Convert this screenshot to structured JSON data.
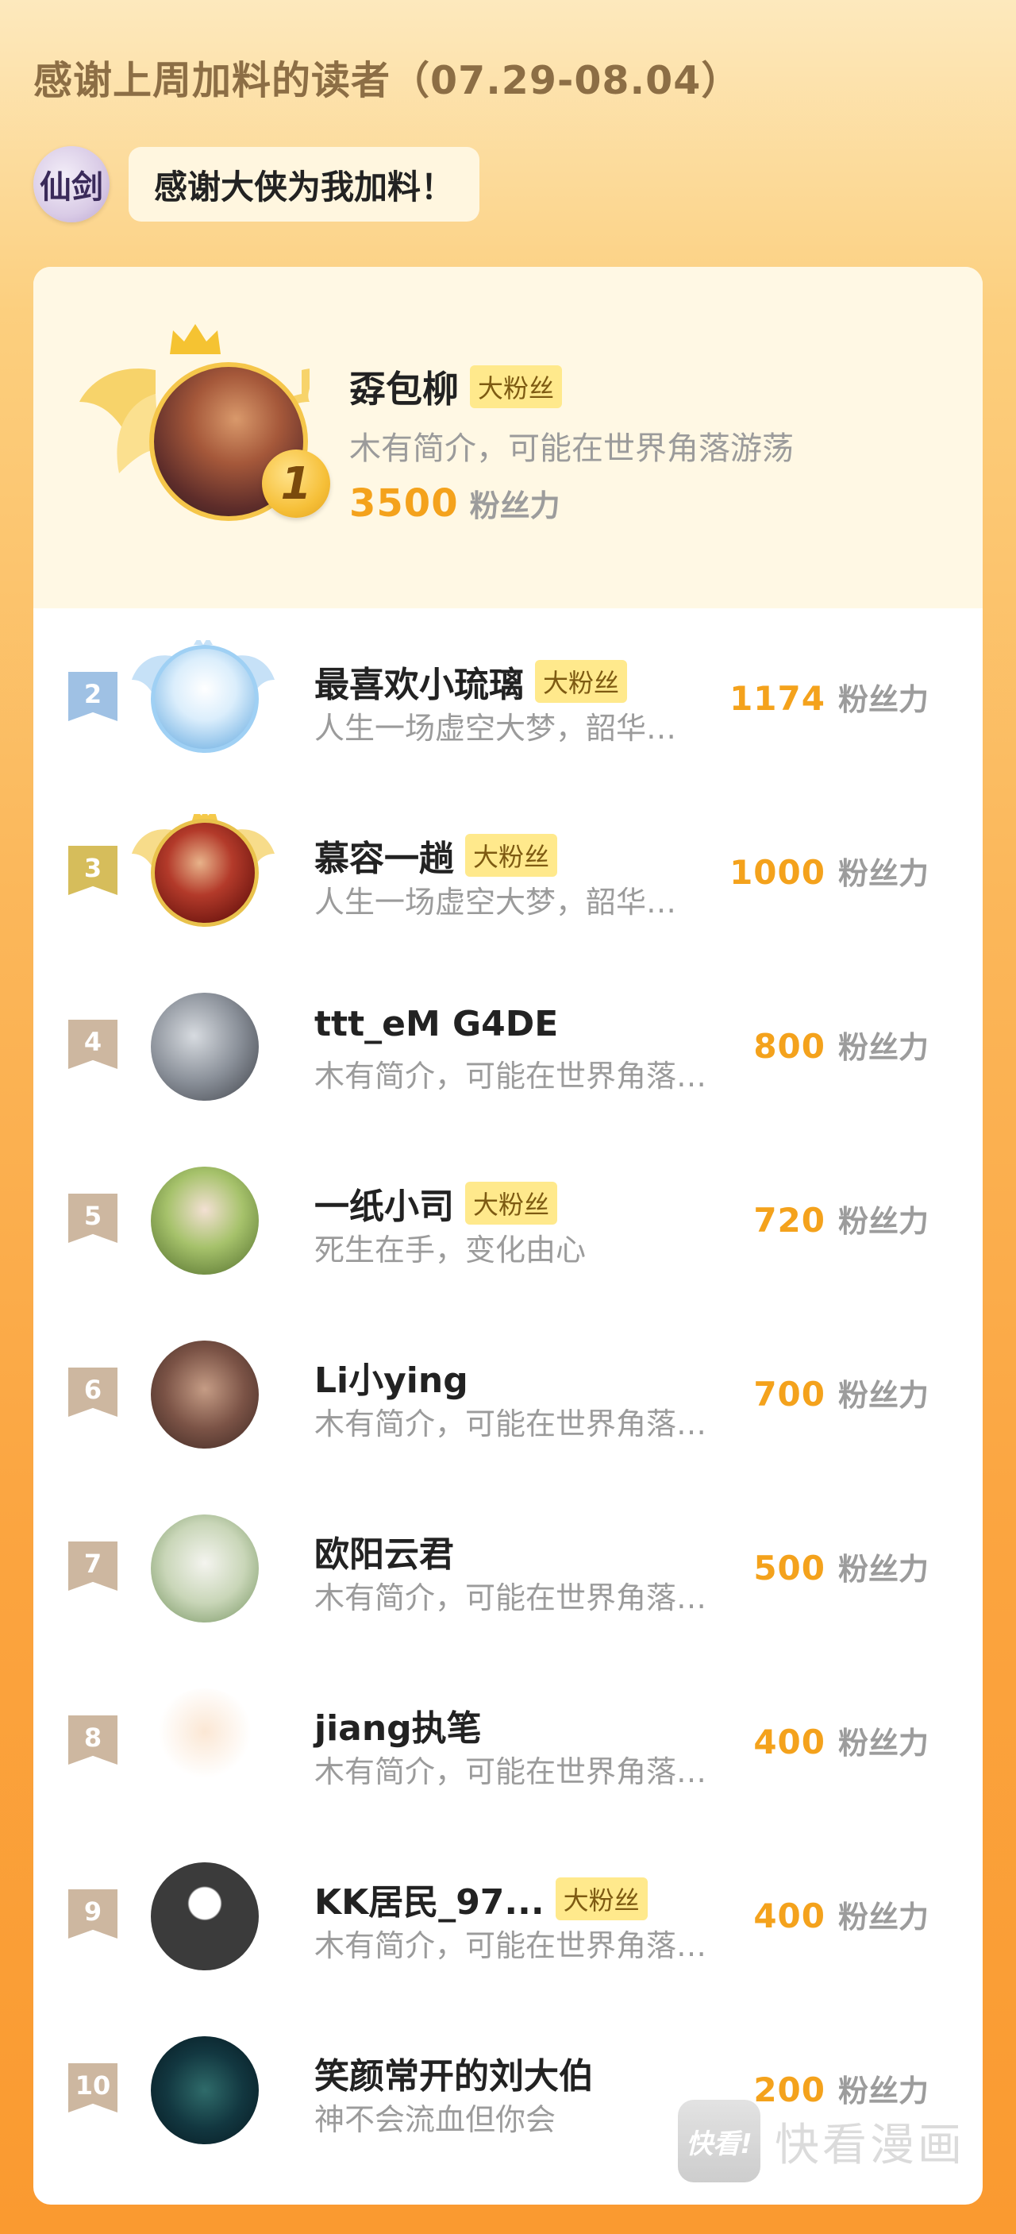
{
  "title": "感谢上周加料的读者（07.29-08.04）",
  "author": {
    "logo_text": "仙剑",
    "thanks_message": "感谢大侠为我加料！"
  },
  "fans_unit": "粉丝力",
  "top_fan": {
    "rank": "1",
    "name": "孬包柳",
    "badge": "大粉丝",
    "bio": "木有简介，可能在世界角落游荡",
    "fans": "3500"
  },
  "fans_list": [
    {
      "rank": "2",
      "name": "最喜欢小琉璃",
      "badge": "大粉丝",
      "bio": "人生一场虚空大梦，韶华…",
      "fans": "1174",
      "flag_color": "#9fc1e4",
      "avatar_style": "radial-gradient(circle at 50% 40%, #ffffff 0%, #dbeefc 40%, #86bde8 80%, #5a9ad4 100%)",
      "avatar_border": "5px solid #9fd0f4",
      "wings": "blue"
    },
    {
      "rank": "3",
      "name": "慕容一趟",
      "badge": "大粉丝",
      "bio": "人生一场虚空大梦，韶华…",
      "fans": "1000",
      "flag_color": "#d6bd5b",
      "avatar_style": "radial-gradient(circle at 45% 40%, #e8b38a 0%, #b33a2a 40%, #7a1c14 75%, #3d120c 100%)",
      "avatar_border": "5px solid #e9c24c",
      "wings": "gold"
    },
    {
      "rank": "4",
      "name": "ttt_eM G4DE",
      "badge": "",
      "bio": "木有简介，可能在世界角落…",
      "fans": "800",
      "flag_color": "#cdb7a0",
      "avatar_style": "radial-gradient(circle at 40% 40%, #d7dbe0 0%, #8a9099 50%, #3c3f46 100%)",
      "avatar_border": "none",
      "wings": ""
    },
    {
      "rank": "5",
      "name": "一纸小司",
      "badge": "大粉丝",
      "bio": "死生在手，变化由心",
      "fans": "720",
      "flag_color": "#cdb7a0",
      "avatar_style": "radial-gradient(circle at 50% 40%, #f3e0d3 0%, #a6c26b 45%, #4f6b2a 100%)",
      "avatar_border": "none",
      "wings": ""
    },
    {
      "rank": "6",
      "name": "Li小ying",
      "badge": "",
      "bio": "木有简介，可能在世界角落…",
      "fans": "700",
      "flag_color": "#cdb7a0",
      "avatar_style": "radial-gradient(circle at 50% 45%, #c59c85 0%, #7b5346 50%, #3b2621 100%)",
      "avatar_border": "none",
      "wings": ""
    },
    {
      "rank": "7",
      "name": "欧阳云君",
      "badge": "",
      "bio": "木有简介，可能在世界角落…",
      "fans": "500",
      "flag_color": "#cdb7a0",
      "avatar_style": "radial-gradient(circle at 50% 45%, #f4f4ef 0%, #c9d6b8 50%, #6f8f5a 100%)",
      "avatar_border": "none",
      "wings": ""
    },
    {
      "rank": "8",
      "name": "jiang执笔",
      "badge": "",
      "bio": "木有简介，可能在世界角落…",
      "fans": "400",
      "flag_color": "#cdb7a0",
      "avatar_style": "radial-gradient(circle at 50% 40%, #fbe7d4 0%, #ffffff 55%, #ffffff 100%)",
      "avatar_border": "none",
      "wings": ""
    },
    {
      "rank": "9",
      "name": "KK居民_97...",
      "badge": "大粉丝",
      "bio": "木有简介，可能在世界角落…",
      "fans": "400",
      "flag_color": "#cdb7a0",
      "avatar_style": "radial-gradient(circle at 50% 38%, #ffffff 0%, #ffffff 18%, #3b3b3b 20%, #3b3b3b 100%)",
      "avatar_border": "none",
      "wings": ""
    },
    {
      "rank": "10",
      "name": "笑颜常开的刘大伯",
      "badge": "",
      "bio": "神不会流血但你会",
      "fans": "200",
      "flag_color": "#cdb7a0",
      "avatar_style": "radial-gradient(circle at 50% 50%, #2f6b6a 0%, #123740 50%, #061820 100%)",
      "avatar_border": "none",
      "wings": ""
    }
  ],
  "watermark": {
    "logo_text": "快看!",
    "text": "快看漫画"
  }
}
